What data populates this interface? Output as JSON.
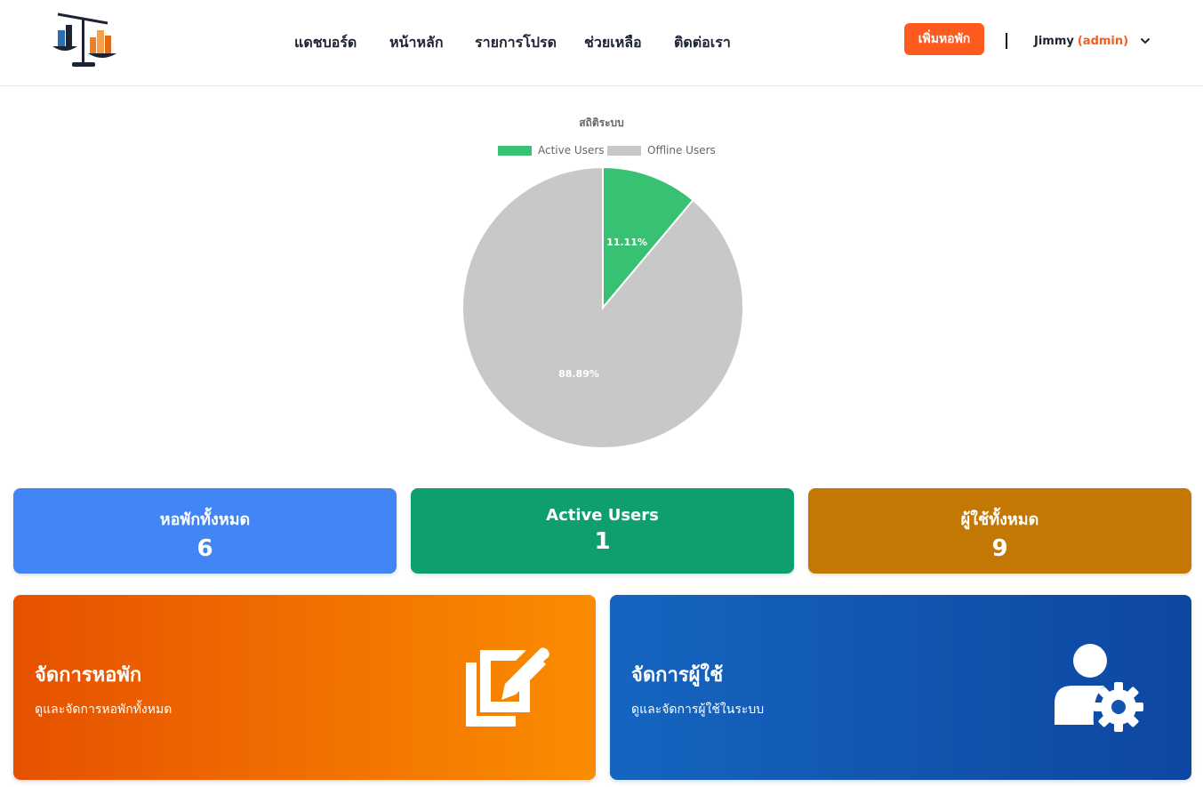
{
  "header": {
    "logo_icon": "scale-buildings-logo",
    "nav": [
      {
        "label": "แดชบอร์ด"
      },
      {
        "label": "หน้าหลัก"
      },
      {
        "label": "รายการโปรด"
      },
      {
        "label": "ช่วยเหลือ"
      },
      {
        "label": "ติดต่อเรา"
      }
    ],
    "add_button": "เพิ่มหอพัก",
    "user": {
      "name": "Jimmy",
      "role": "(admin)",
      "menu_icon": "chevron-down-icon"
    }
  },
  "chart_data": {
    "type": "pie",
    "title": "สถิติระบบ",
    "legend_position": "top",
    "categories": [
      "Active Users",
      "Offline Users"
    ],
    "values": [
      1,
      8
    ],
    "percent_labels": [
      "11.11%",
      "88.89%"
    ],
    "colors": [
      "#38c172",
      "#c8c8c8"
    ]
  },
  "stats": [
    {
      "label": "หอพักทั้งหมด",
      "value": "6",
      "color": "#4285f4"
    },
    {
      "label": "Active Users",
      "value": "1",
      "color": "#0f9f6e"
    },
    {
      "label": "ผู้ใช้ทั้งหมด",
      "value": "9",
      "color": "#c27803"
    }
  ],
  "actions": [
    {
      "title": "จัดการหอพัก",
      "desc": "ดูและจัดการหอพักทั้งหมด",
      "icon": "edit-document-icon",
      "gradient": [
        "#e65100",
        "#fb8c00"
      ]
    },
    {
      "title": "จัดการผู้ใช้",
      "desc": "ดูและจัดการผู้ใช้ในระบบ",
      "icon": "user-settings-icon",
      "gradient": [
        "#1565c0",
        "#0d47a1"
      ]
    }
  ]
}
